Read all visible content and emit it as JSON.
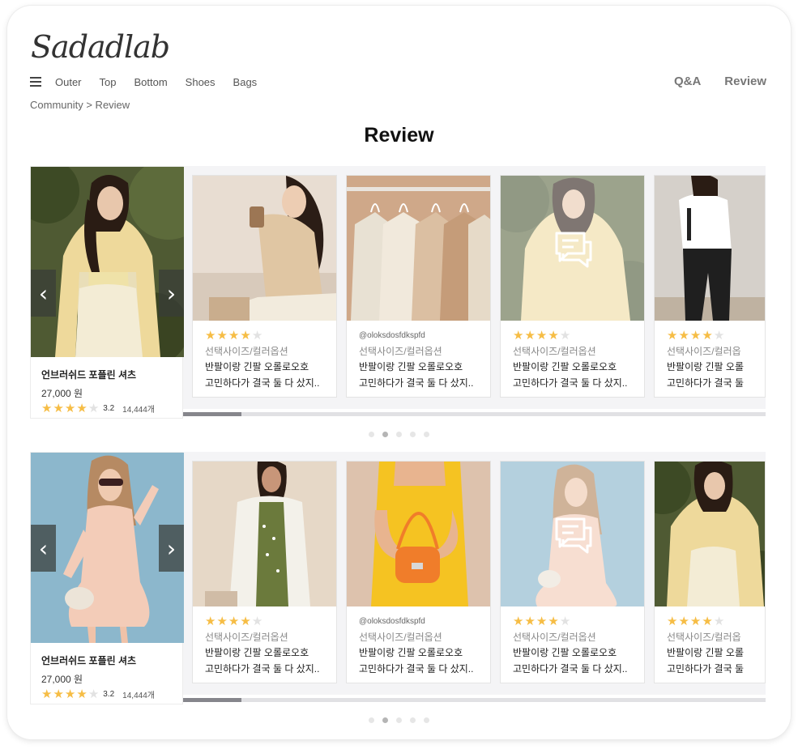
{
  "brand": {
    "logo_text": "Sadadlab"
  },
  "nav": {
    "items": [
      {
        "label": "Outer"
      },
      {
        "label": "Top"
      },
      {
        "label": "Bottom"
      },
      {
        "label": "Shoes"
      },
      {
        "label": "Bags"
      }
    ],
    "right_links": [
      {
        "label": "Q&A"
      },
      {
        "label": "Review"
      }
    ]
  },
  "breadcrumb": "Community > Review",
  "page_title": "Review",
  "colors": {
    "star": "#f6bd45",
    "star_empty": "#e2e2e2",
    "section_bg": "#f4f4f6"
  },
  "icons": {
    "menu": "hamburger-menu-icon",
    "prev": "chevron-left-icon",
    "next": "chevron-right-icon",
    "review_overlay": "chat-bubble-icon"
  },
  "sections": [
    {
      "product": {
        "name": "언브러쉬드 포플린 셔츠",
        "price": "27,000 원",
        "stars": 4,
        "rating": "3.2",
        "review_count": "14,444개",
        "prev_glyph": "‹",
        "next_glyph": "›"
      },
      "reviews": [
        {
          "stars": 4,
          "user": "",
          "option": "선택사이즈/컬러옵션",
          "line1": "반팔이랑 긴팔 오롤로오호",
          "line2": "고민하다가 결국 둘 다 샀지.."
        },
        {
          "stars": 0,
          "user": "@oloksdosfdkspfd",
          "option": "선택사이즈/컬러옵션",
          "line1": "반팔이랑 긴팔 오롤로오호",
          "line2": "고민하다가 결국 둘 다 샀지.."
        },
        {
          "stars": 4,
          "user": "",
          "option": "선택사이즈/컬러옵션",
          "line1": "반팔이랑 긴팔 오롤로오호",
          "line2": "고민하다가 결국 둘 다 샀지.."
        },
        {
          "stars": 4,
          "user": "",
          "option": "선택사이즈/컬러옵",
          "line1": "반팔이랑 긴팔 오롤",
          "line2": "고민하다가 결국 둘"
        }
      ],
      "scroll_progress": 0.1,
      "pagination": {
        "total": 5,
        "active": 2
      }
    },
    {
      "product": {
        "name": "언브러쉬드 포플린 셔츠",
        "price": "27,000 원",
        "stars": 4,
        "rating": "3.2",
        "review_count": "14,444개",
        "prev_glyph": "‹",
        "next_glyph": "›"
      },
      "reviews": [
        {
          "stars": 4,
          "user": "",
          "option": "선택사이즈/컬러옵션",
          "line1": "반팔이랑 긴팔 오롤로오호",
          "line2": "고민하다가 결국 둘 다 샀지.."
        },
        {
          "stars": 0,
          "user": "@oloksdosfdkspfd",
          "option": "선택사이즈/컬러옵션",
          "line1": "반팔이랑 긴팔 오롤로오호",
          "line2": "고민하다가 결국 둘 다 샀지.."
        },
        {
          "stars": 4,
          "user": "",
          "option": "선택사이즈/컬러옵션",
          "line1": "반팔이랑 긴팔 오롤로오호",
          "line2": "고민하다가 결국 둘 다 샀지.."
        },
        {
          "stars": 4,
          "user": "",
          "option": "선택사이즈/컬러옵",
          "line1": "반팔이랑 긴팔 오롤",
          "line2": "고민하다가 결국 둘"
        }
      ],
      "scroll_progress": 0.1,
      "pagination": {
        "total": 5,
        "active": 2
      }
    }
  ]
}
